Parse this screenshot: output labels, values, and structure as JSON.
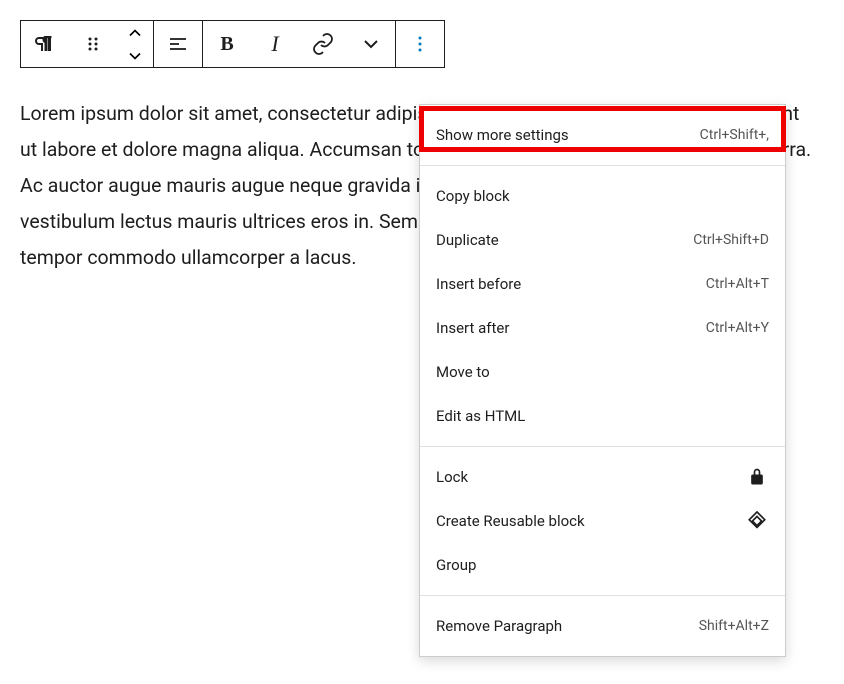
{
  "content": {
    "paragraph": "Lorem ipsum dolor sit amet, consectetur adipiscing elit, sed do eiusmod tempor incididunt ut labore et dolore magna aliqua. Accumsan tortor posuere ac ut consequat semper viverra. Ac auctor augue mauris augue neque gravida in fermentum. Pharetra magna ac placerat vestibulum lectus mauris ultrices eros in. Semper eget duis at tellus. Metus dictum at tempor commodo ullamcorper a lacus."
  },
  "dropdown": {
    "group1": [
      {
        "label": "Show more settings",
        "shortcut": "Ctrl+Shift+,"
      }
    ],
    "group2": [
      {
        "label": "Copy block",
        "shortcut": ""
      },
      {
        "label": "Duplicate",
        "shortcut": "Ctrl+Shift+D"
      },
      {
        "label": "Insert before",
        "shortcut": "Ctrl+Alt+T"
      },
      {
        "label": "Insert after",
        "shortcut": "Ctrl+Alt+Y"
      },
      {
        "label": "Move to",
        "shortcut": ""
      },
      {
        "label": "Edit as HTML",
        "shortcut": ""
      }
    ],
    "group3": [
      {
        "label": "Lock",
        "icon": "lock"
      },
      {
        "label": "Create Reusable block",
        "icon": "reusable"
      },
      {
        "label": "Group",
        "icon": ""
      }
    ],
    "group4": [
      {
        "label": "Remove Paragraph",
        "shortcut": "Shift+Alt+Z"
      }
    ]
  },
  "toolbar": {
    "bold_label": "B",
    "italic_label": "I"
  }
}
